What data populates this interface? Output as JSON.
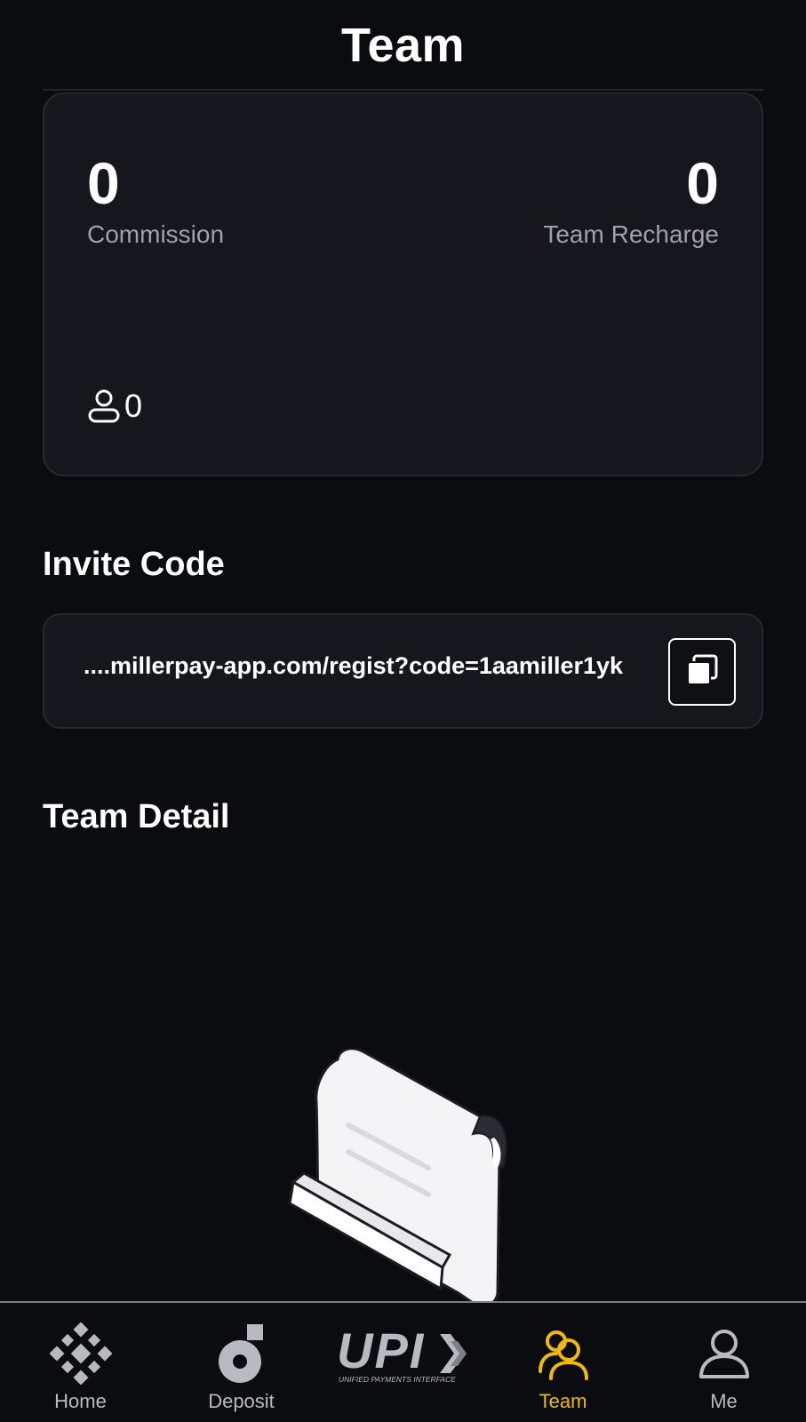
{
  "header": {
    "title": "Team"
  },
  "stats": {
    "commission": {
      "value": "0",
      "label": "Commission"
    },
    "team_recharge": {
      "value": "0",
      "label": "Team Recharge"
    },
    "member_count": "0"
  },
  "invite": {
    "title": "Invite Code",
    "link": "....millerpay-app.com/regist?code=1aamiller1yk"
  },
  "team_detail": {
    "title": "Team Detail"
  },
  "nav": {
    "items": [
      {
        "label": "Home",
        "icon": "home-icon"
      },
      {
        "label": "Deposit",
        "icon": "deposit-icon"
      },
      {
        "label": "",
        "icon": "upi-logo"
      },
      {
        "label": "Team",
        "icon": "team-icon",
        "active": true
      },
      {
        "label": "Me",
        "icon": "me-icon"
      }
    ],
    "active_color": "#f0b90b",
    "upi_logo_text": "UPI",
    "upi_subtitle": "UNIFIED PAYMENTS INTERFACE"
  }
}
